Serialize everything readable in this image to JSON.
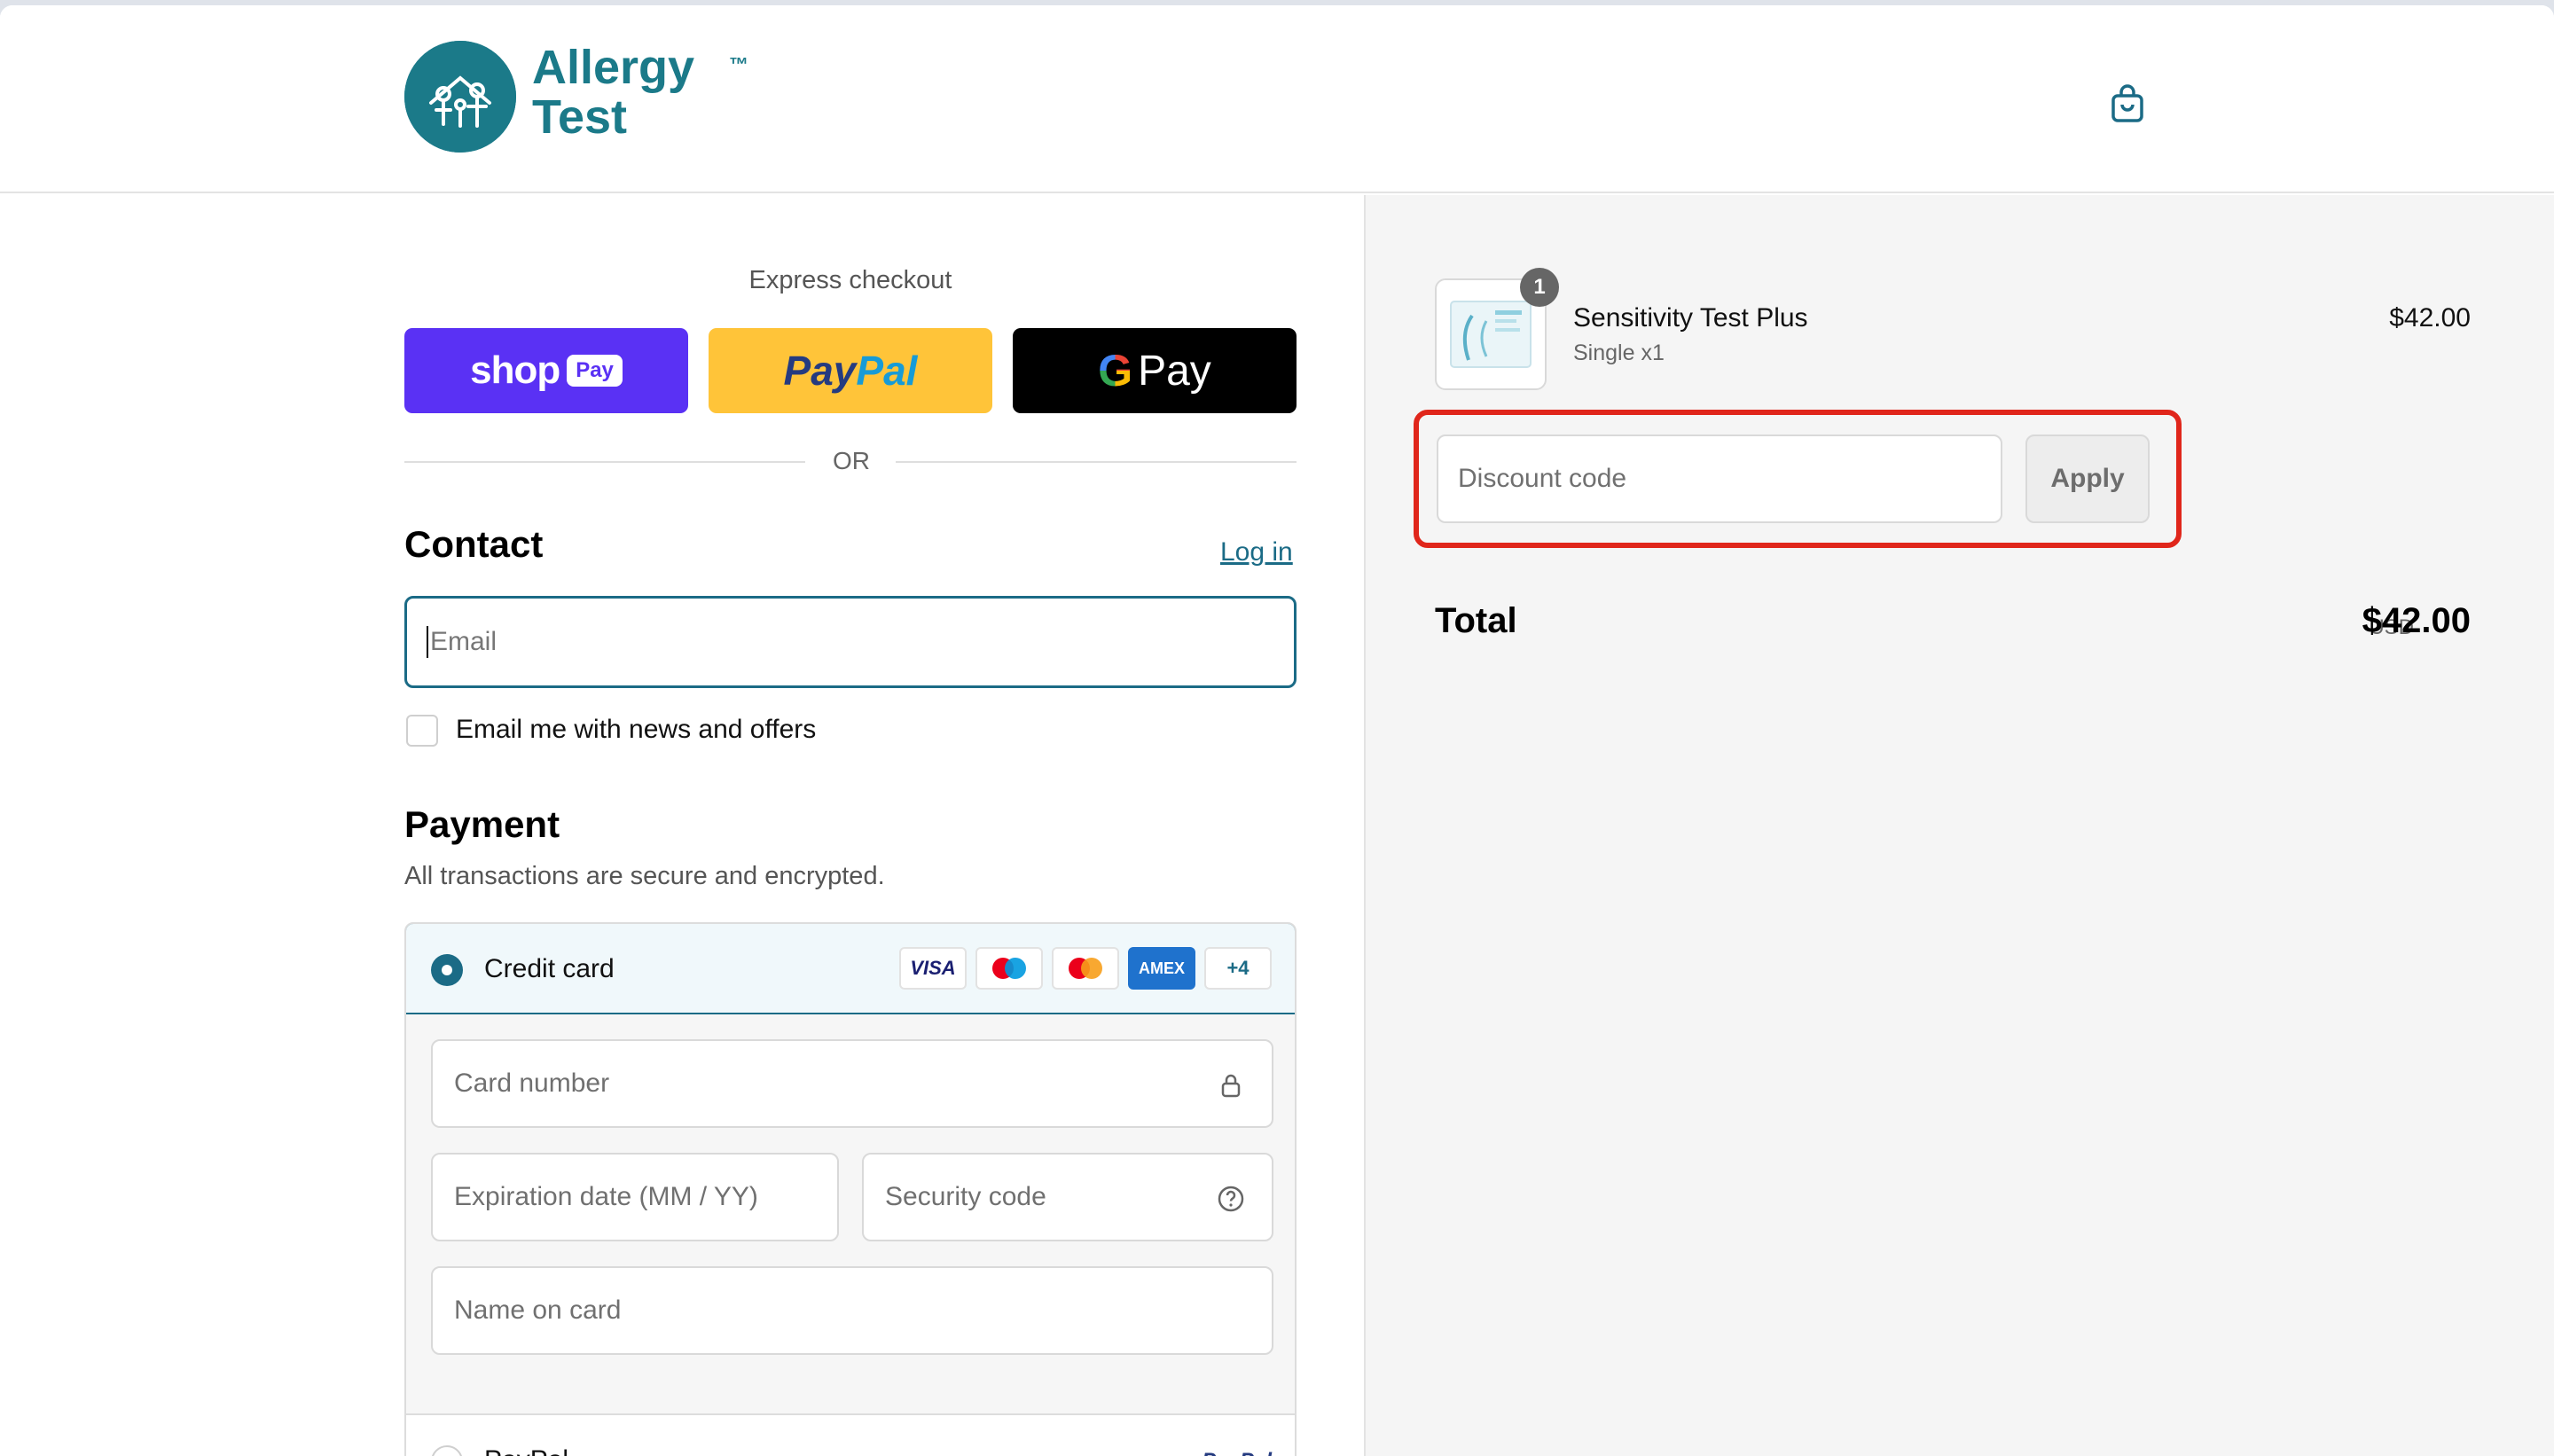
{
  "brand": {
    "line1": "Allergy",
    "line2": "Test",
    "tm": "™",
    "color": "#1b7a89"
  },
  "express": {
    "title": "Express checkout",
    "shop_pay": {
      "word": "shop",
      "badge": "Pay"
    },
    "paypal": {
      "part1": "Pay",
      "part2": "Pal"
    },
    "gpay": {
      "g": "G",
      "word": "Pay"
    },
    "or": "OR"
  },
  "contact": {
    "heading": "Contact",
    "login": "Log in",
    "email_placeholder": "Email",
    "newsletter_label": "Email me with news and offers"
  },
  "payment": {
    "heading": "Payment",
    "subtitle": "All transactions are secure and encrypted.",
    "credit_card_label": "Credit card",
    "card_brands": [
      "VISA",
      "Maestro",
      "Mastercard",
      "AMEX",
      "+4"
    ],
    "card_number": "Card number",
    "expiration": "Expiration date (MM / YY)",
    "security_code": "Security code",
    "name_on_card": "Name on card",
    "paypal_label": "PayPal",
    "paypal_logo": "PayPal"
  },
  "order": {
    "qty": "1",
    "product_name": "Sensitivity Test Plus",
    "variant": "Single x1",
    "price": "$42.00",
    "discount_placeholder": "Discount code",
    "apply": "Apply",
    "total_label": "Total",
    "currency": "USD",
    "total": "$42.00"
  },
  "colors": {
    "accent": "#1b6b86",
    "shop": "#5a31f4",
    "paypal": "#ffc439",
    "highlight": "#e0261b"
  }
}
